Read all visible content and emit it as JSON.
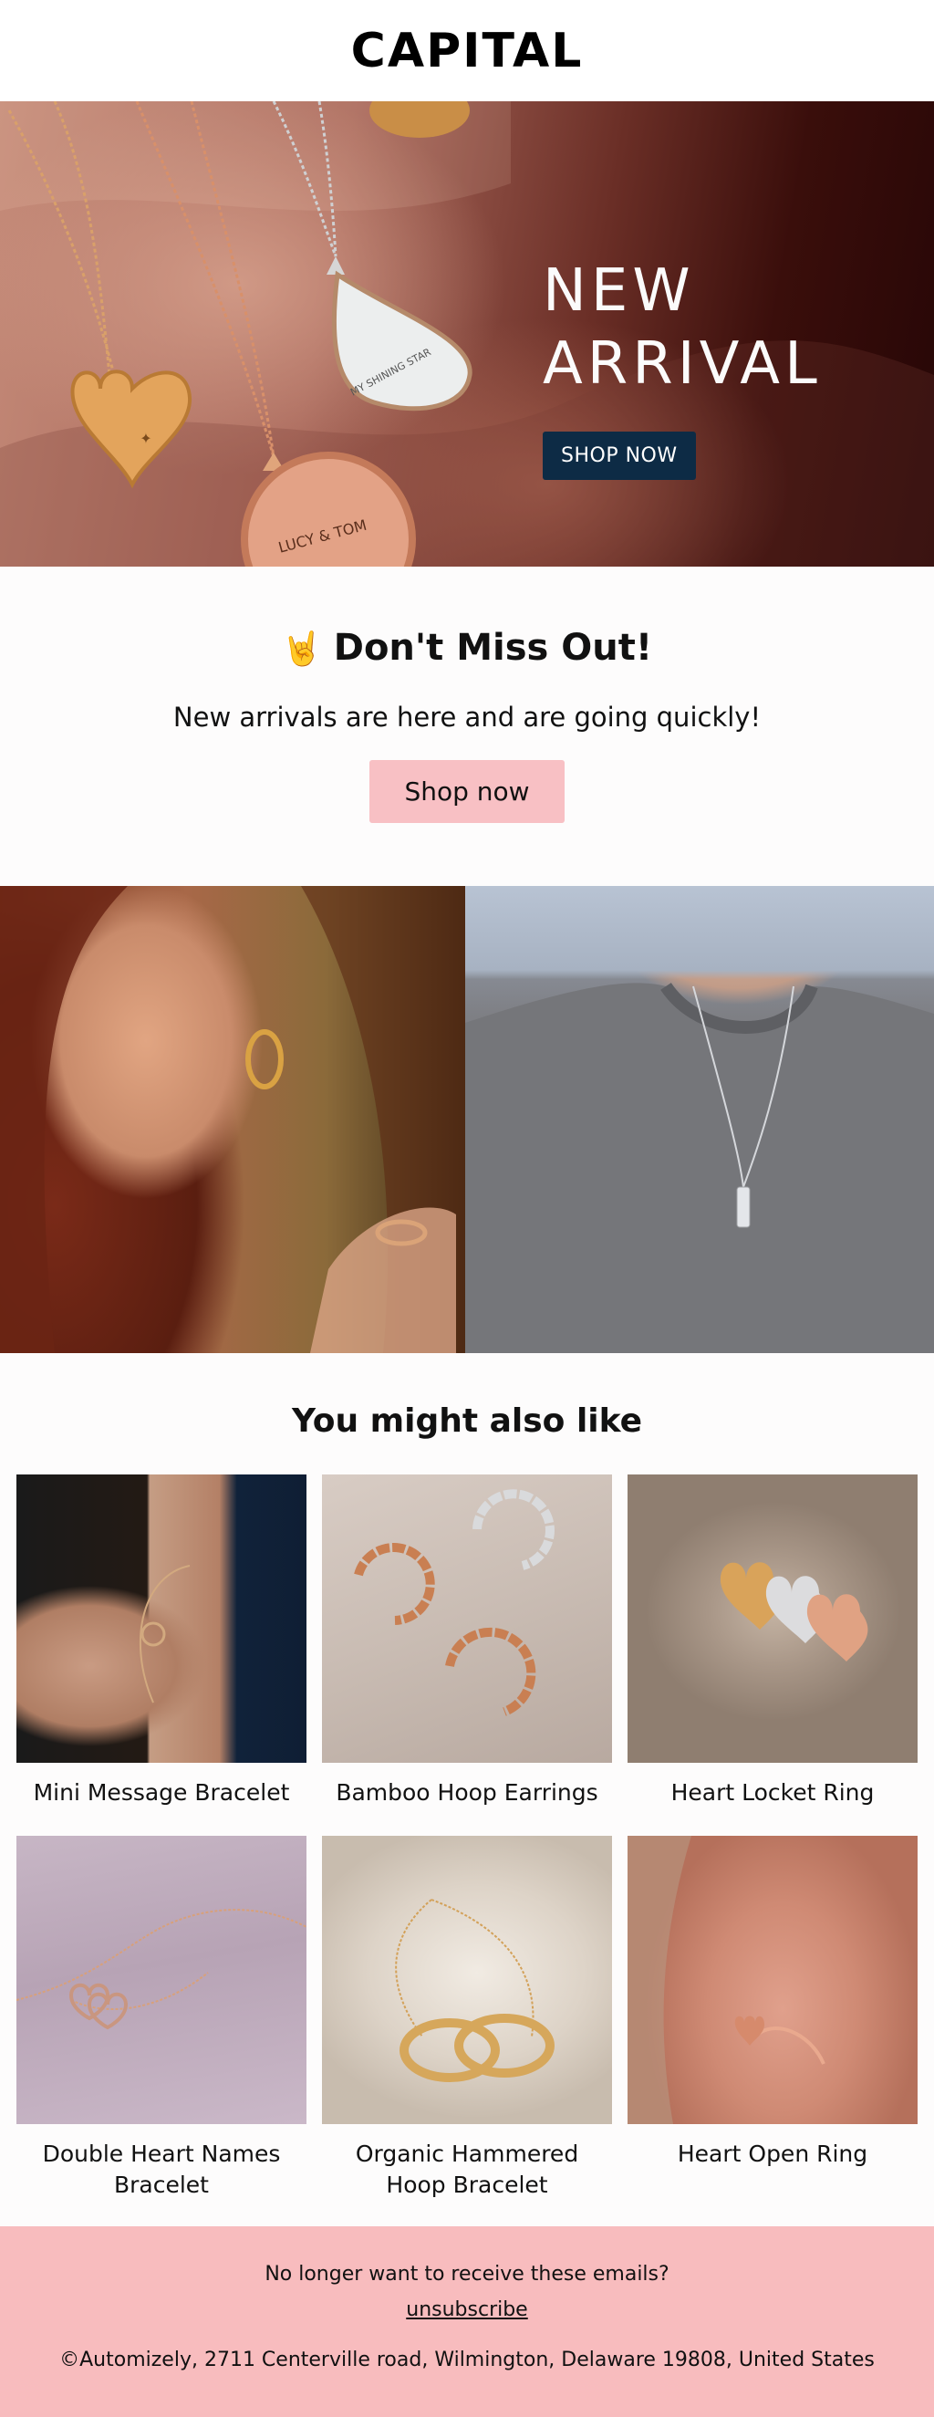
{
  "header": {
    "logo": "CAPITAL"
  },
  "hero": {
    "title": "NEW\nARRIVAL",
    "cta_label": "SHOP NOW",
    "locket_engravings": [
      "MY SHINING STAR",
      "LUCY & TOM"
    ]
  },
  "promo": {
    "emoji": "🤘",
    "title": "Don't Miss Out!",
    "subtitle": "New arrivals are here and are going quickly!",
    "cta_label": "Shop now",
    "cta_color": "#f8c0c4"
  },
  "recommendations": {
    "title": "You might also like",
    "products": [
      {
        "name": "Mini Message Bracelet"
      },
      {
        "name": "Bamboo Hoop Earrings"
      },
      {
        "name": "Heart Locket Ring"
      },
      {
        "name": "Double Heart Names Bracelet"
      },
      {
        "name": "Organic Hammered Hoop Bracelet"
      },
      {
        "name": "Heart Open Ring"
      }
    ]
  },
  "footer": {
    "question": "No longer want to receive these emails?",
    "unsubscribe_label": "unsubscribe",
    "address": "©Automizely, 2711 Centerville road, Wilmington, Delaware 19808, United States",
    "background_color": "#f8bcbe"
  },
  "colors": {
    "hero_button": "#0d2b45",
    "promo_button": "#f8c0c4",
    "footer_bg": "#f8bcbe"
  }
}
